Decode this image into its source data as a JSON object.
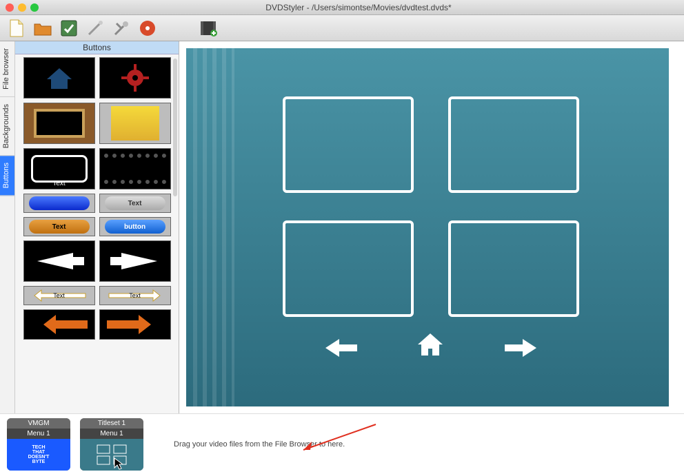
{
  "window": {
    "title": "DVDStyler - /Users/simontse/Movies/dvdtest.dvds*"
  },
  "toolbar_icons": [
    "new-icon",
    "open-icon",
    "save-icon",
    "wizard-icon",
    "settings-icon",
    "burn-icon",
    "video-add-icon"
  ],
  "side_tabs": [
    {
      "label": "File browser",
      "active": false
    },
    {
      "label": "Backgrounds",
      "active": false
    },
    {
      "label": "Buttons",
      "active": true
    }
  ],
  "left_panel": {
    "title": "Buttons",
    "items": {
      "text_label": "Text",
      "pill_text": "Text",
      "pill_button": "button",
      "arrow_text": "Text"
    }
  },
  "bottom": {
    "group1": {
      "title": "VMGM",
      "sub": "Menu 1",
      "thumb_text": "TECH\nTHAT\nDOESN'T\nBYTE"
    },
    "group2": {
      "title": "Titleset 1",
      "sub": "Menu 1"
    },
    "hint": "Drag your video files from the File Browser to here."
  }
}
